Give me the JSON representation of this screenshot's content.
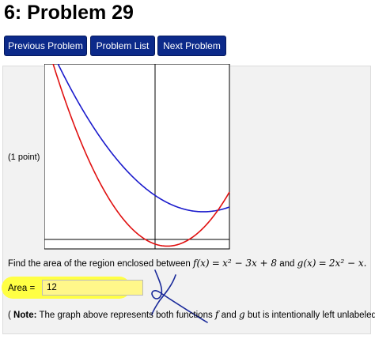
{
  "page": {
    "title": "6: Problem 29"
  },
  "nav": {
    "prev_label": "Previous Problem",
    "list_label": "Problem List",
    "next_label": "Next Problem"
  },
  "problem": {
    "points": "(1 point)",
    "question_prefix": "Find the area of the region enclosed between",
    "f_name": "f(x)",
    "eq1": "=",
    "f_expr": "x² − 3x + 8",
    "and": "and",
    "g_name": "g(x)",
    "eq2": "=",
    "g_expr": "2x² − x.",
    "answer_label": "Area =",
    "answer_value": "12",
    "note_open": "(",
    "note_bold": "Note:",
    "note_text1": "The graph above represents both functions",
    "note_f": "f",
    "note_and": "and",
    "note_g": "g",
    "note_text2": "but is intentionally left unlabeled.)"
  },
  "colors": {
    "button_bg": "#0c2a8a",
    "f_curve": "#1a1acc",
    "g_curve": "#e01010",
    "highlight": "#ffff3a",
    "annotation_ink": "#1a2a9a"
  }
}
